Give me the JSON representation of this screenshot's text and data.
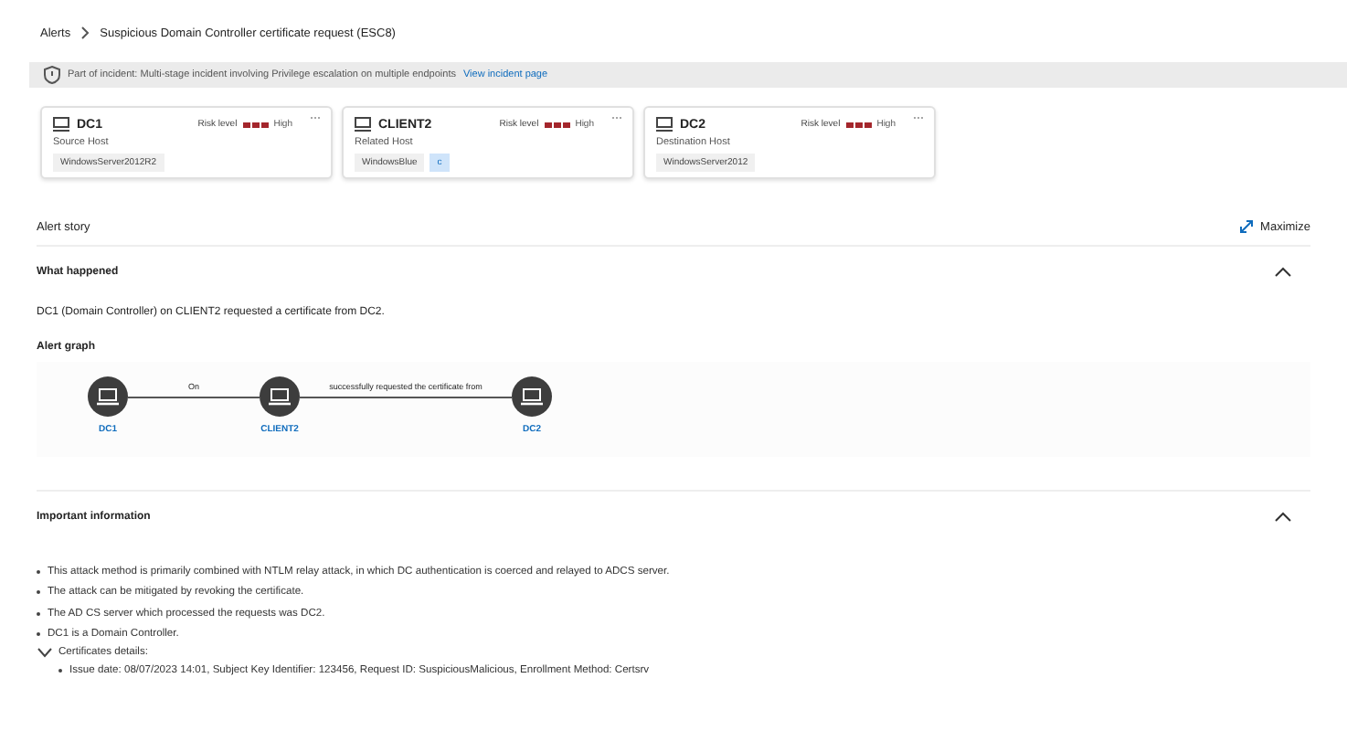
{
  "breadcrumb": [
    "Alerts",
    "Suspicious Domain Controller certificate request (ESC8)"
  ],
  "banner": {
    "text": "Part of incident: Multi-stage incident involving Privilege escalation on multiple endpoints",
    "link": "View incident page"
  },
  "hosts": [
    {
      "name": "DC1",
      "role": "Source Host",
      "risk_label": "Risk level",
      "risk_value": "High",
      "risk_bars": [
        {
          "on": true
        },
        {
          "on": true
        },
        {
          "on": true
        }
      ],
      "tags": [
        "WindowsServer2012R2"
      ]
    },
    {
      "name": "CLIENT2",
      "role": "Related Host",
      "risk_label": "Risk level",
      "risk_value": "High",
      "risk_bars": [
        {
          "on": true
        },
        {
          "on": true
        },
        {
          "on": true
        }
      ],
      "tags": [
        "WindowsBlue"
      ],
      "extra": "c"
    },
    {
      "name": "DC2",
      "role": "Destination Host",
      "risk_label": "Risk level",
      "risk_value": "High",
      "risk_bars": [
        {
          "on": true
        },
        {
          "on": true
        },
        {
          "on": true
        }
      ],
      "tags": [
        "WindowsServer2012"
      ]
    }
  ],
  "story": {
    "title": "Alert story",
    "maximize": "Maximize"
  },
  "what_happened": {
    "title": "What happened",
    "expanded": true,
    "text": "DC1 (Domain Controller) on CLIENT2 requested a certificate from DC2.",
    "graph_title": "Alert graph",
    "nodes": [
      "DC1",
      "CLIENT2",
      "DC2"
    ],
    "edges": [
      "On",
      "successfully requested the certificate from"
    ]
  },
  "important": {
    "title": "Important information",
    "expanded": true,
    "bullets": [
      "This attack method is primarily combined with NTLM relay attack, in which DC authentication is coerced and relayed to ADCS server.",
      "The attack can be mitigated by revoking the certificate.",
      "The AD CS server which processed the requests was DC2.",
      "DC1 is a Domain Controller."
    ],
    "details": {
      "title": "Certificates details:",
      "expanded": true,
      "items": [
        "Issue date: 08/07/2023 14:01, Subject Key Identifier: 123456, Request ID: SuspiciousMalicious, Enrollment Method: Certsrv"
      ]
    }
  }
}
